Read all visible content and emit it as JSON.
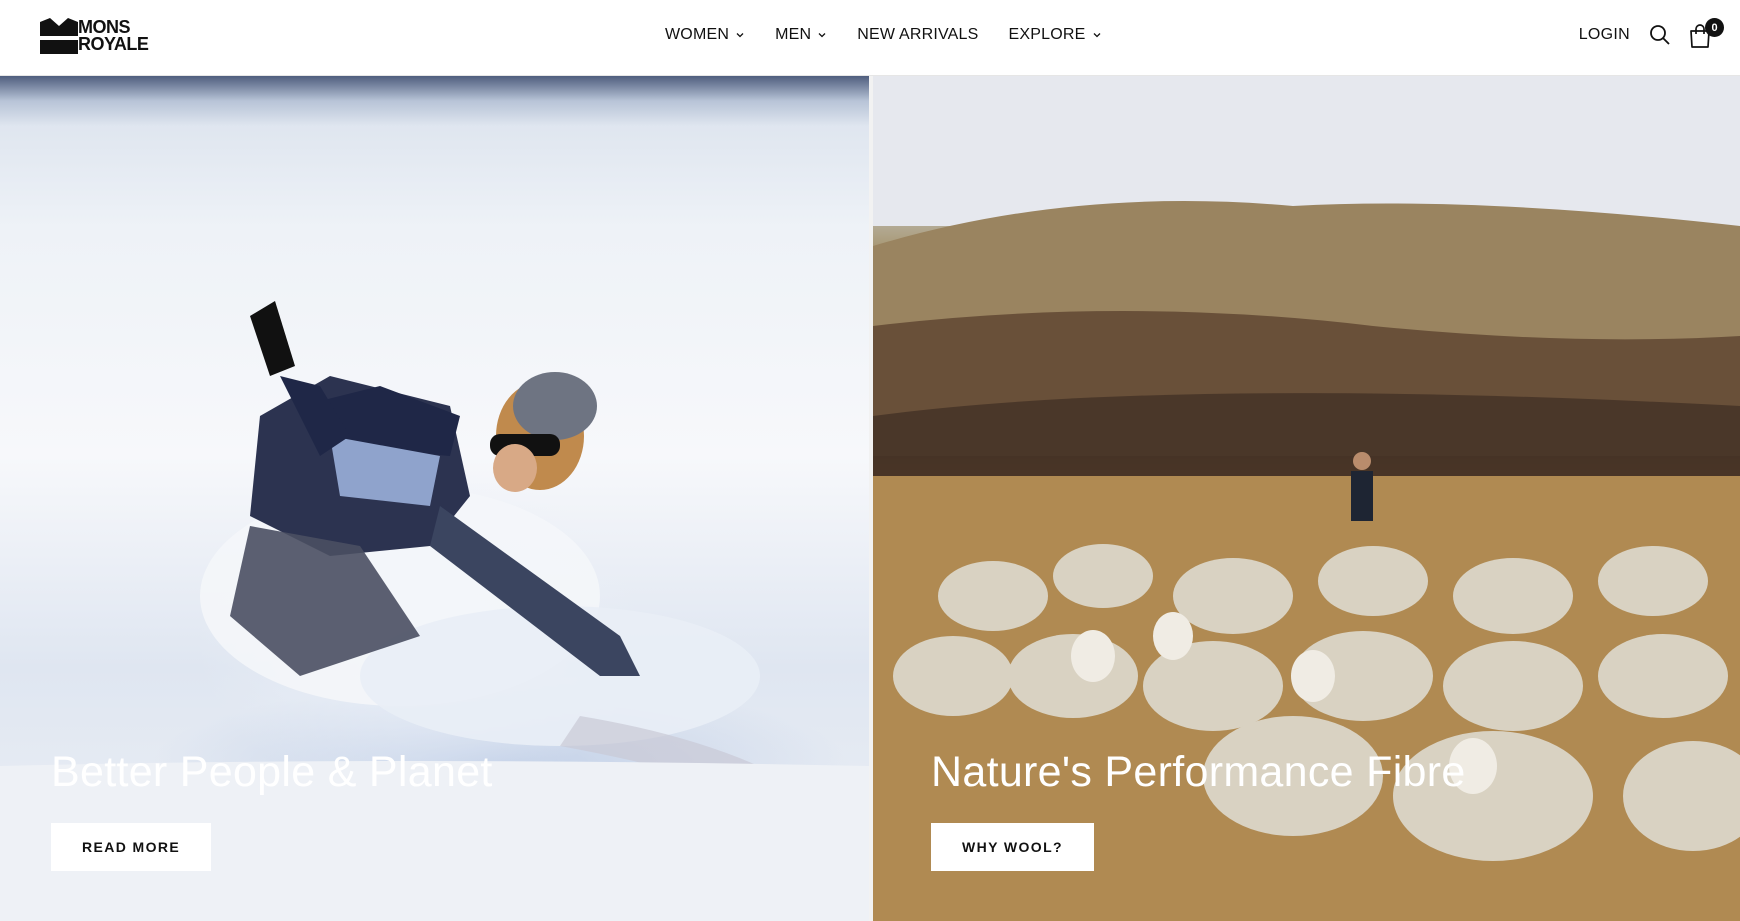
{
  "brand": {
    "line1": "MONS",
    "line2": "ROYALE"
  },
  "nav": {
    "items": [
      {
        "label": "WOMEN",
        "has_dropdown": true
      },
      {
        "label": "MEN",
        "has_dropdown": true
      },
      {
        "label": "NEW ARRIVALS",
        "has_dropdown": false
      },
      {
        "label": "EXPLORE",
        "has_dropdown": true
      }
    ]
  },
  "utility": {
    "login_label": "LOGIN",
    "cart_count": "0"
  },
  "hero": {
    "left": {
      "heading": "Better People & Planet",
      "cta_label": "READ MORE"
    },
    "right": {
      "heading": "Nature's Performance Fibre",
      "cta_label": "WHY WOOL?"
    }
  },
  "colors": {
    "text": "#111111",
    "header_bg": "#ffffff",
    "button_bg": "#ffffff"
  }
}
